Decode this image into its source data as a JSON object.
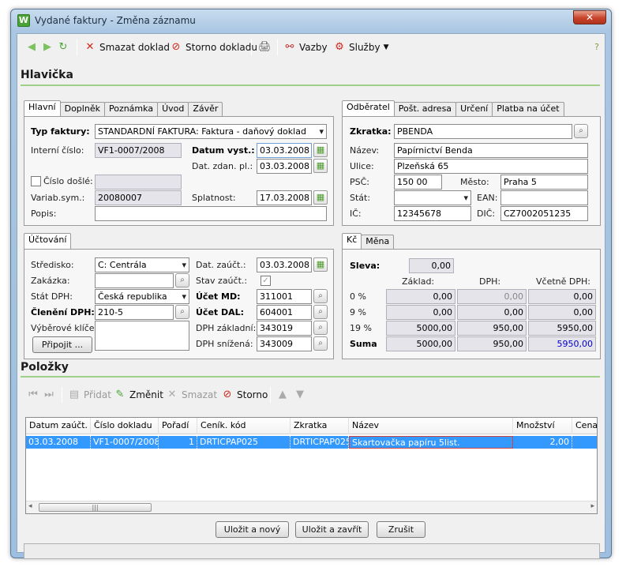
{
  "window": {
    "title": "Vydané faktury - Změna záznamu",
    "app_icon": "W"
  },
  "toolbar": {
    "delete_label": "Smazat doklad",
    "storno_label": "Storno dokladu",
    "links_label": "Vazby",
    "services_label": "Služby"
  },
  "header": {
    "title": "Hlavička",
    "tabs": [
      "Hlavní",
      "Doplněk",
      "Poznámka",
      "Úvod",
      "Závěr"
    ],
    "invoice_type_label": "Typ faktury:",
    "invoice_type_value": "STANDARDNÍ FAKTURA: Faktura - daňový doklad",
    "internal_no_label": "Interní číslo:",
    "internal_no_value": "VF1-0007/2008",
    "issue_date_label": "Datum vyst.:",
    "issue_date_value": "03.03.2008",
    "tax_date_label": "Dat. zdan. pl.:",
    "tax_date_value": "03.03.2008",
    "received_no_label": "Číslo došlé:",
    "received_no_value": "",
    "var_symbol_label": "Variab.sym.:",
    "var_symbol_value": "20080007",
    "due_label": "Splatnost:",
    "due_value": "17.03.2008",
    "desc_label": "Popis:",
    "desc_value": ""
  },
  "customer": {
    "tabs": [
      "Odběratel",
      "Pošt. adresa",
      "Určení",
      "Platba na účet"
    ],
    "short_label": "Zkratka:",
    "short_value": "PBENDA",
    "name_label": "Název:",
    "name_value": "Papírnictví Benda",
    "street_label": "Ulice:",
    "street_value": "Plzeňská 65",
    "zip_label": "PSČ:",
    "zip_value": "150 00",
    "city_label": "Město:",
    "city_value": "Praha 5",
    "country_label": "Stát:",
    "country_value": "",
    "ean_label": "EAN:",
    "ean_value": "",
    "ic_label": "IČ:",
    "ic_value": "12345678",
    "dic_label": "DIČ:",
    "dic_value": "CZ7002051235"
  },
  "accounting": {
    "tab": "Účtování",
    "center_label": "Středisko:",
    "center_value": "C: Centrála",
    "order_label": "Zakázka:",
    "order_value": "",
    "vat_state_label": "Stát DPH:",
    "vat_state_value": "Česká republika",
    "vat_class_label": "Členění DPH:",
    "vat_class_value": "210-5",
    "keys_label": "Výběrové klíče:",
    "attach_label": "Připojit ...",
    "acc_date_label": "Dat. zaúčt.:",
    "acc_date_value": "03.03.2008",
    "acc_state_label": "Stav zaúčt.:",
    "md_label": "Účet MD:",
    "md_value": "311001",
    "dal_label": "Účet DAL:",
    "dal_value": "604001",
    "vat_base_label": "DPH základní:",
    "vat_base_value": "343019",
    "vat_low_label": "DPH snížená:",
    "vat_low_value": "343009"
  },
  "summary": {
    "tabs": [
      "Kč",
      "Měna"
    ],
    "discount_label": "Sleva:",
    "discount_value": "0,00",
    "cols": [
      "Základ:",
      "DPH:",
      "Včetně DPH:"
    ],
    "rows": [
      {
        "label": "0 %",
        "base": "0,00",
        "vat": "0,00",
        "total": "0,00"
      },
      {
        "label": "9 %",
        "base": "0,00",
        "vat": "0,00",
        "total": "0,00"
      },
      {
        "label": "19 %",
        "base": "5000,00",
        "vat": "950,00",
        "total": "5950,00"
      },
      {
        "label": "Suma",
        "base": "5000,00",
        "vat": "950,00",
        "total": "5950,00"
      }
    ]
  },
  "items": {
    "title": "Položky",
    "toolbar": {
      "add": "Přidat",
      "edit": "Změnit",
      "delete": "Smazat",
      "storno": "Storno"
    },
    "columns": [
      "Datum zaúčt.",
      "Číslo dokladu",
      "Pořadí",
      "Ceník. kód",
      "Zkratka",
      "Název",
      "Množství",
      "Cena z"
    ],
    "rows": [
      [
        "03.03.2008",
        "VF1-0007/2008",
        "1",
        "DRTICPAP025",
        "DRTICPAP025",
        "Skartovačka papíru 5list.",
        "2,00",
        ""
      ]
    ]
  },
  "buttons": {
    "save_new": "Uložit a nový",
    "save_close": "Uložit a zavřít",
    "cancel": "Zrušit"
  },
  "colors": {
    "section_line": "#9fd08a",
    "selection": "#3399ff",
    "total_blue": "#0000cc"
  }
}
